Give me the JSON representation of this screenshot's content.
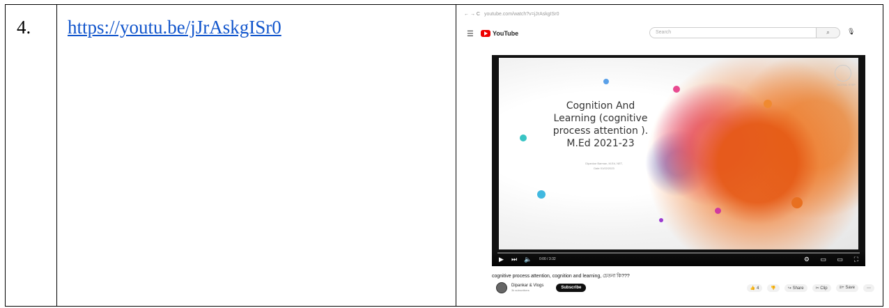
{
  "row": {
    "number": "4.",
    "link": "https://youtu.be/jJrAskgISr0"
  },
  "screenshot": {
    "browser_url": "youtube.com/watch?v=jJrAskgISr0",
    "logo_text": "YouTube",
    "search_placeholder": "Search",
    "slide": {
      "title_lines": [
        "Cognition And",
        "Learning (cognitive",
        "process attention ).",
        "M.Ed 2021-23"
      ],
      "presenter_lines": [
        "Dipankar Barman, M.Ed, NET,",
        "Date 01/02/2023"
      ],
      "watermark": "DIGITAL STEP"
    },
    "video_time": "0:00 / 3:32",
    "video_title": "cognitive process attention, cognition and learning, চেতনা কি???",
    "channel_name": "Dipankar & Vlogs",
    "channel_subs": "3k subscribers",
    "subscribe_label": "Subscribe",
    "actions": [
      "👍 4",
      "👎",
      "↪ Share",
      "✂ Clip",
      "≡+ Save",
      "⋯"
    ],
    "colors": {
      "yt_red": "#e00000",
      "link_blue": "#1155cc"
    }
  }
}
